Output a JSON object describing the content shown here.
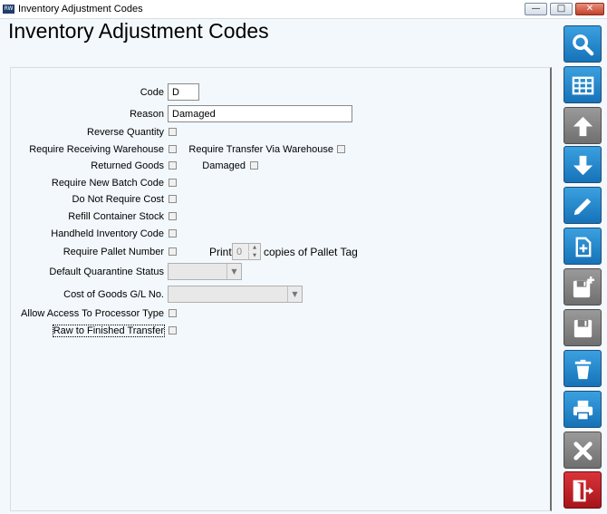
{
  "window": {
    "title": "Inventory Adjustment Codes",
    "logo_text": "RW"
  },
  "page": {
    "title": "Inventory Adjustment Codes"
  },
  "form": {
    "code": {
      "label": "Code",
      "value": "D"
    },
    "reason": {
      "label": "Reason",
      "value": "Damaged"
    },
    "reverse_quantity": {
      "label": "Reverse Quantity",
      "checked": false
    },
    "require_receiving_warehouse": {
      "label": "Require Receiving Warehouse",
      "checked": false
    },
    "require_transfer_via_warehouse": {
      "label": "Require Transfer Via Warehouse",
      "checked": false
    },
    "returned_goods": {
      "label": "Returned Goods",
      "checked": false
    },
    "damaged": {
      "label": "Damaged",
      "checked": false
    },
    "require_new_batch_code": {
      "label": "Require New Batch Code",
      "checked": false
    },
    "do_not_require_cost": {
      "label": "Do Not Require Cost",
      "checked": false
    },
    "refill_container_stock": {
      "label": "Refill Container Stock",
      "checked": false
    },
    "handheld_inventory_code": {
      "label": "Handheld Inventory Code",
      "checked": false
    },
    "require_pallet_number": {
      "label": "Require Pallet Number",
      "checked": false
    },
    "print_copies": {
      "prefix": "Print",
      "value": "0",
      "suffix": "copies of Pallet Tag"
    },
    "default_quarantine_status": {
      "label": "Default Quarantine Status",
      "value": ""
    },
    "cost_of_goods_gl": {
      "label": "Cost of Goods G/L No.",
      "value": ""
    },
    "allow_access_processor_type": {
      "label": "Allow Access To Processor Type",
      "checked": false
    },
    "raw_to_finished_transfer": {
      "label": "Raw to Finished Transfer",
      "checked": false
    }
  },
  "toolbar": [
    {
      "name": "search",
      "icon": "search-icon",
      "color": "blue"
    },
    {
      "name": "list",
      "icon": "grid-icon",
      "color": "blue"
    },
    {
      "name": "previous",
      "icon": "arrow-up-icon",
      "color": "gray"
    },
    {
      "name": "next",
      "icon": "arrow-down-icon",
      "color": "blue"
    },
    {
      "name": "edit",
      "icon": "pencil-icon",
      "color": "blue"
    },
    {
      "name": "new",
      "icon": "new-document-icon",
      "color": "blue"
    },
    {
      "name": "save-new",
      "icon": "save-plus-icon",
      "color": "gray"
    },
    {
      "name": "save",
      "icon": "save-icon",
      "color": "gray"
    },
    {
      "name": "delete",
      "icon": "trash-icon",
      "color": "blue"
    },
    {
      "name": "print",
      "icon": "printer-icon",
      "color": "blue"
    },
    {
      "name": "cancel",
      "icon": "x-icon",
      "color": "gray"
    },
    {
      "name": "exit",
      "icon": "exit-door-icon",
      "color": "red"
    }
  ]
}
